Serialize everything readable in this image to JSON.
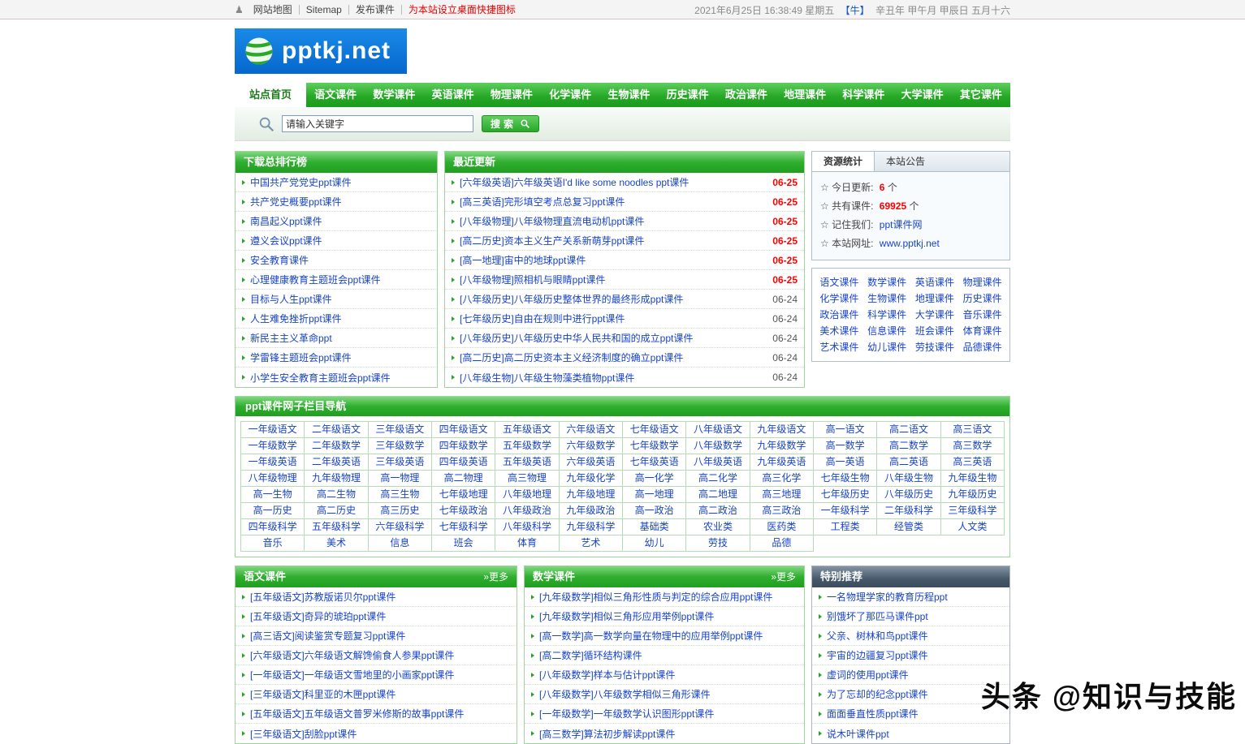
{
  "topbar": {
    "icon_glyph": "♟",
    "links": [
      "网站地图",
      "Sitemap",
      "发布课件"
    ],
    "shortcut": "为本站设立桌面快捷图标",
    "datetime": "2021年6月25日 16:38:49 星期五",
    "zodiac": "【牛】",
    "lunar": "辛丑年 甲午月 甲辰日 五月十六"
  },
  "logo": {
    "text": "pptkj.net"
  },
  "nav": {
    "home": "站点首页",
    "items": [
      "语文课件",
      "数学课件",
      "英语课件",
      "物理课件",
      "化学课件",
      "生物课件",
      "历史课件",
      "政治课件",
      "地理课件",
      "科学课件",
      "大学课件",
      "其它课件"
    ]
  },
  "search": {
    "placeholder": "请输入关键字",
    "button": "搜索"
  },
  "ranking": {
    "title": "下载总排行榜",
    "items": [
      "中国共产党党史ppt课件",
      "共产党史概要ppt课件",
      "南昌起义ppt课件",
      "遵义会议ppt课件",
      "安全教育课件",
      "心理健康教育主题班会ppt课件",
      "目标与人生ppt课件",
      "人生难免挫折ppt课件",
      "新民主主义革命ppt",
      "学雷锋主题班会ppt课件",
      "小学生安全教育主题班会ppt课件"
    ]
  },
  "recent": {
    "title": "最近更新",
    "items": [
      {
        "title": "[六年级英语]六年级英语I'd like some noodles ppt课件",
        "date": "06-25",
        "cls": "hot"
      },
      {
        "title": "[高三英语]完形填空考点总复习ppt课件",
        "date": "06-25",
        "cls": "hot"
      },
      {
        "title": "[八年级物理]八年级物理直流电动机ppt课件",
        "date": "06-25",
        "cls": "hot"
      },
      {
        "title": "[高二历史]资本主义生产关系新萌芽ppt课件",
        "date": "06-25",
        "cls": "hot"
      },
      {
        "title": "[高一地理]宙中的地球ppt课件",
        "date": "06-25",
        "cls": "hot"
      },
      {
        "title": "[八年级物理]照相机与眼睛ppt课件",
        "date": "06-25",
        "cls": "hot"
      },
      {
        "title": "[八年级历史]八年级历史整体世界的最终形成ppt课件",
        "date": "06-24"
      },
      {
        "title": "[七年级历史]自由在规则中进行ppt课件",
        "date": "06-24"
      },
      {
        "title": "[八年级历史]八年级历史中华人民共和国的成立ppt课件",
        "date": "06-24"
      },
      {
        "title": "[高二历史]高二历史资本主义经济制度的确立ppt课件",
        "date": "06-24"
      },
      {
        "title": "[八年级生物]八年级生物藻类植物ppt课件",
        "date": "06-24"
      }
    ]
  },
  "stats": {
    "tab_active": "资源统计",
    "tab_inactive": "本站公告",
    "rows": [
      {
        "label": "☆ 今日更新:",
        "value": "6",
        "suffix": " 个"
      },
      {
        "label": "☆ 共有课件:",
        "value": "69925",
        "suffix": " 个"
      },
      {
        "label": "☆ 记住我们:",
        "value": "ppt课件网",
        "suffix": "",
        "cls": "linkval"
      },
      {
        "label": "☆ 本站网址:",
        "value": "www.pptkj.net",
        "suffix": "",
        "cls": "linkval"
      }
    ]
  },
  "quicklinks": {
    "items": [
      "语文课件",
      "数学课件",
      "英语课件",
      "物理课件",
      "化学课件",
      "生物课件",
      "地理课件",
      "历史课件",
      "政治课件",
      "科学课件",
      "大学课件",
      "音乐课件",
      "美术课件",
      "信息课件",
      "班会课件",
      "体育课件",
      "艺术课件",
      "幼儿课件",
      "劳技课件",
      "品德课件"
    ]
  },
  "subnav": {
    "title": "ppt课件网子栏目导航",
    "items": [
      "一年级语文",
      "二年级语文",
      "三年级语文",
      "四年级语文",
      "五年级语文",
      "六年级语文",
      "七年级语文",
      "八年级语文",
      "九年级语文",
      "高一语文",
      "高二语文",
      "高三语文",
      "一年级数学",
      "二年级数学",
      "三年级数学",
      "四年级数学",
      "五年级数学",
      "六年级数学",
      "七年级数学",
      "八年级数学",
      "九年级数学",
      "高一数学",
      "高二数学",
      "高三数学",
      "一年级英语",
      "二年级英语",
      "三年级英语",
      "四年级英语",
      "五年级英语",
      "六年级英语",
      "七年级英语",
      "八年级英语",
      "九年级英语",
      "高一英语",
      "高二英语",
      "高三英语",
      "八年级物理",
      "九年级物理",
      "高一物理",
      "高二物理",
      "高三物理",
      "九年级化学",
      "高一化学",
      "高二化学",
      "高三化学",
      "七年级生物",
      "八年级生物",
      "九年级生物",
      "高一生物",
      "高二生物",
      "高三生物",
      "七年级地理",
      "八年级地理",
      "九年级地理",
      "高一地理",
      "高二地理",
      "高三地理",
      "七年级历史",
      "八年级历史",
      "九年级历史",
      "高一历史",
      "高二历史",
      "高三历史",
      "七年级政治",
      "八年级政治",
      "九年级政治",
      "高一政治",
      "高二政治",
      "高三政治",
      "一年级科学",
      "二年级科学",
      "三年级科学",
      "四年级科学",
      "五年级科学",
      "六年级科学",
      "七年级科学",
      "八年级科学",
      "九年级科学",
      "基础类",
      "农业类",
      "医药类",
      "工程类",
      "经管类",
      "人文类",
      "音乐",
      "美术",
      "信息",
      "班会",
      "体育",
      "艺术",
      "幼儿",
      "劳技",
      "品德"
    ]
  },
  "chinese": {
    "title": "语文课件",
    "more": "»更多",
    "items": [
      "[五年级语文]苏教版诺贝尔ppt课件",
      "[五年级语文]奇异的琥珀ppt课件",
      "[高三语文]阅读鉴赏专题复习ppt课件",
      "[六年级语文]六年级语文解馋偷食人参果ppt课件",
      "[一年级语文]一年级语文雪地里的小画家ppt课件",
      "[三年级语文]科里亚的木匣ppt课件",
      "[五年级语文]五年级语文普罗米修斯的故事ppt课件",
      "[三年级语文]刮脸ppt课件"
    ]
  },
  "math": {
    "title": "数学课件",
    "more": "»更多",
    "items": [
      "[九年级数学]相似三角形性质与判定的综合应用ppt课件",
      "[九年级数学]相似三角形应用举例ppt课件",
      "[高一数学]高一数学向量在物理中的应用举例ppt课件",
      "[高二数学]循环结构课件",
      "[八年级数学]样本与估计ppt课件",
      "[八年级数学]八年级数学相似三角形课件",
      "[一年级数学]一年级数学认识图形ppt课件",
      "[高三数学]算法初步解读ppt课件"
    ]
  },
  "featured": {
    "title": "特别推荐",
    "items": [
      "一名物理学家的教育历程ppt",
      "别饿坏了那匹马课件ppt",
      "父亲、树林和鸟ppt课件",
      "宇宙的边疆复习ppt课件",
      "虚词的使用ppt课件",
      "为了忘却的纪念ppt课件",
      "面面垂直性质ppt课件",
      "说木叶课件ppt"
    ]
  },
  "watermark": {
    "brand": "头条",
    "handle": "@知识与技能"
  }
}
